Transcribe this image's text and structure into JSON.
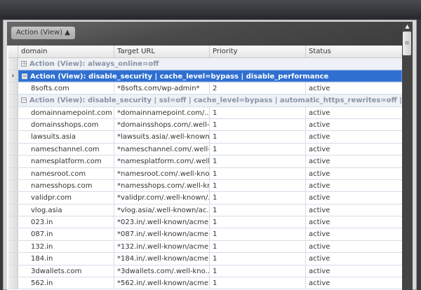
{
  "group_chip": "Action (View) ▲",
  "columns": [
    "domain",
    "Target URL",
    "Priority",
    "Status"
  ],
  "groups": [
    {
      "label": "Action (View): always_online=off",
      "toggle": "⊞"
    },
    {
      "label": "Action (View): disable_security | cache_level=bypass | disable_performance",
      "toggle": "⊟"
    },
    {
      "label": "Action (View): disable_security | ssl=off | cache_level=bypass | automatic_https_rewrites=off | disa...",
      "toggle": "⊟"
    }
  ],
  "selected_indicator": "›",
  "group2_rows": [
    {
      "domain": "8softs.com",
      "url": "*8softs.com/wp-admin*",
      "priority": "2",
      "status": "active"
    }
  ],
  "group3_rows": [
    {
      "domain": "domainnamepoint.com",
      "url": "*domainnamepoint.com/....",
      "priority": "1",
      "status": "active"
    },
    {
      "domain": "domainsshops.com",
      "url": "*domainsshops.com/.well-...",
      "priority": "1",
      "status": "active"
    },
    {
      "domain": "lawsuits.asia",
      "url": "*lawsuits.asia/.well-known...",
      "priority": "1",
      "status": "active"
    },
    {
      "domain": "nameschannel.com",
      "url": "*nameschannel.com/.well-...",
      "priority": "1",
      "status": "active"
    },
    {
      "domain": "namesplatform.com",
      "url": "*namesplatform.com/.well...",
      "priority": "1",
      "status": "active"
    },
    {
      "domain": "namesroot.com",
      "url": "*namesroot.com/.well-kno...",
      "priority": "1",
      "status": "active"
    },
    {
      "domain": "namesshops.com",
      "url": "*namesshops.com/.well-kn...",
      "priority": "1",
      "status": "active"
    },
    {
      "domain": "validpr.com",
      "url": "*validpr.com/.well-known/...",
      "priority": "1",
      "status": "active"
    },
    {
      "domain": "vlog.asia",
      "url": "*vlog.asia/.well-known/ac...",
      "priority": "1",
      "status": "active"
    },
    {
      "domain": "023.in",
      "url": "*023.in/.well-known/acme...",
      "priority": "1",
      "status": "active"
    },
    {
      "domain": "087.in",
      "url": "*087.in/.well-known/acme...",
      "priority": "1",
      "status": "active"
    },
    {
      "domain": "132.in",
      "url": "*132.in/.well-known/acme...",
      "priority": "1",
      "status": "active"
    },
    {
      "domain": "184.in",
      "url": "*184.in/.well-known/acme...",
      "priority": "1",
      "status": "active"
    },
    {
      "domain": "3dwallets.com",
      "url": "*3dwallets.com/.well-kno...",
      "priority": "1",
      "status": "active"
    },
    {
      "domain": "562.in",
      "url": "*562.in/.well-known/acme...",
      "priority": "1",
      "status": "active"
    }
  ]
}
